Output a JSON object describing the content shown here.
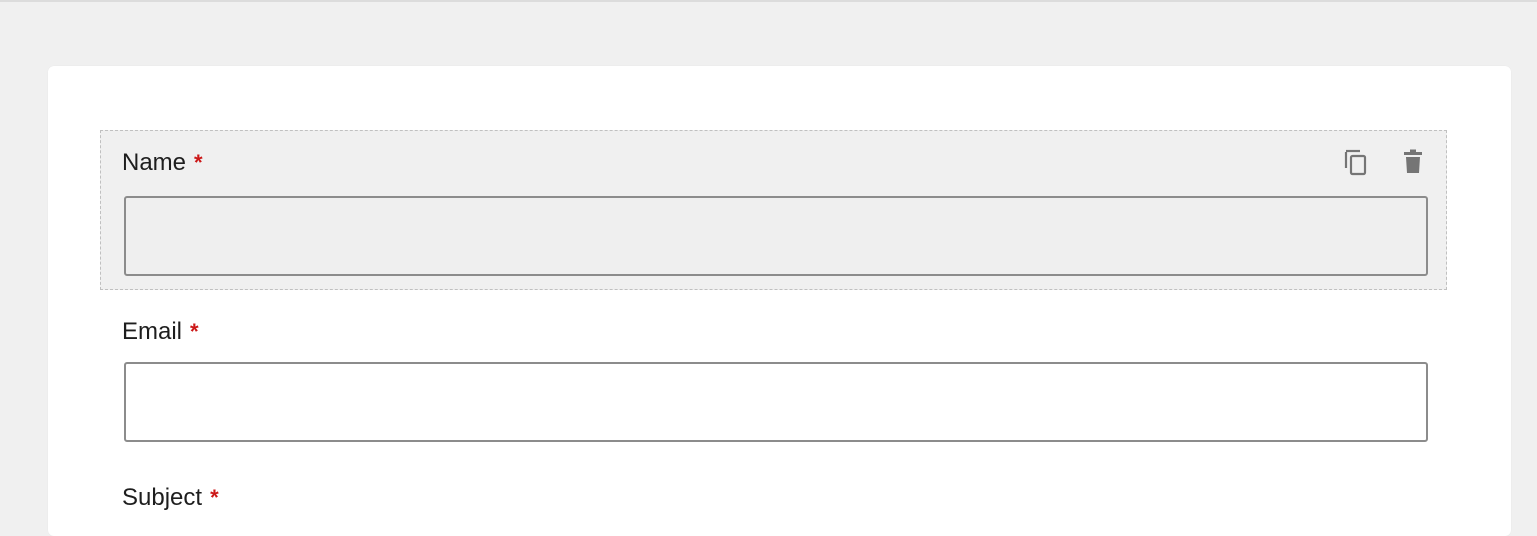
{
  "form": {
    "fields": [
      {
        "label": "Name",
        "required_mark": "*",
        "value": "",
        "placeholder": ""
      },
      {
        "label": "Email",
        "required_mark": "*",
        "value": "",
        "placeholder": ""
      },
      {
        "label": "Subject",
        "required_mark": "*",
        "value": "",
        "placeholder": ""
      }
    ]
  },
  "icons": {
    "drag": "drag-handle-icon",
    "duplicate": "duplicate-icon",
    "delete": "trash-icon"
  },
  "colors": {
    "required": "#cc1818",
    "selected_bg": "#f0f0f0",
    "icon": "#757575"
  }
}
